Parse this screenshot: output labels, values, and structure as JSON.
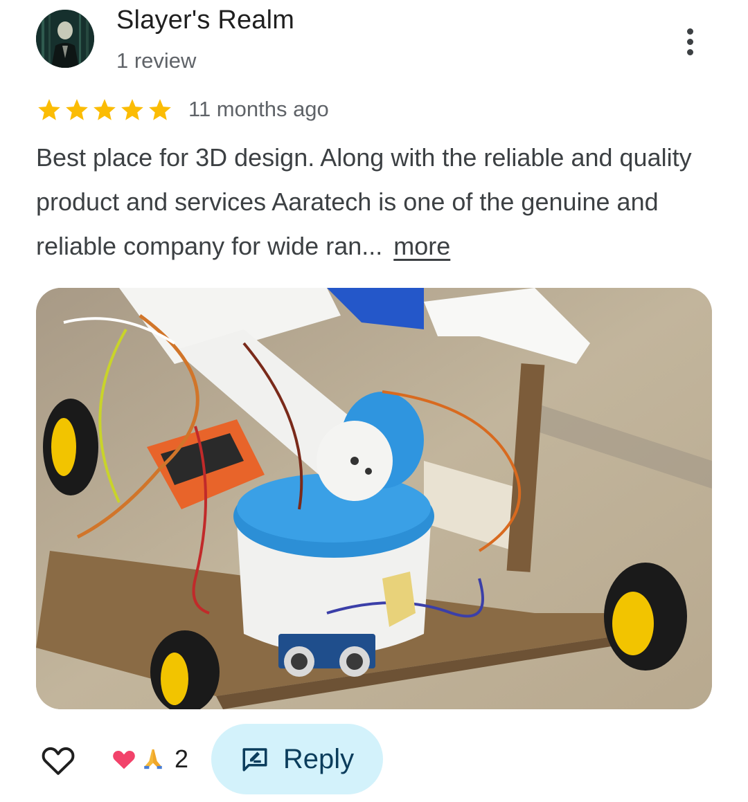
{
  "reviewer": {
    "name": "Slayer's Realm",
    "review_count": "1 review"
  },
  "review": {
    "rating": 5,
    "time_ago": "11 months ago",
    "text": "Best place for 3D design. Along with the reliable and quality product and services Aaratech is one of the genuine and reliable company for wide ran...",
    "more_label": "more",
    "photo_alt": "Robot car with arm"
  },
  "actions": {
    "reaction_count": "2",
    "reply_label": "Reply"
  },
  "colors": {
    "star": "#fbbc04",
    "reply_bg": "#d3f2fb",
    "reply_text": "#0b3d5c"
  }
}
